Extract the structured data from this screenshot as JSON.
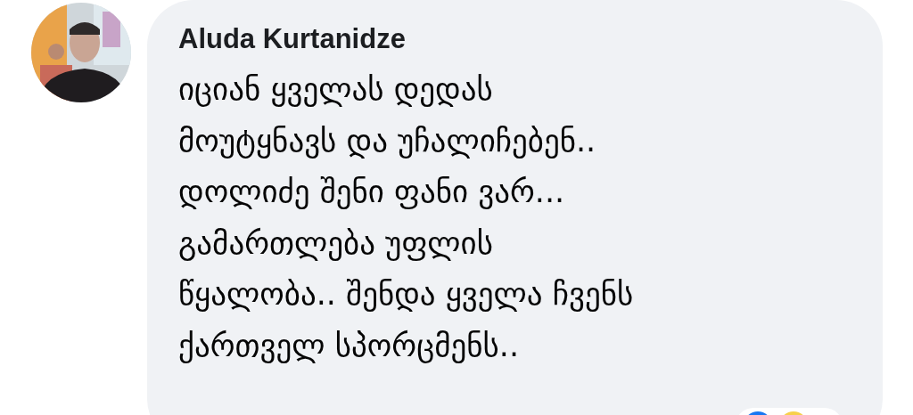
{
  "comment": {
    "author": "Aluda Kurtanidze",
    "text": "იციან ყველას დედას\nმოუტყნავს და უჩალიჩებენ..\nდოლიძე შენი ფანი ვარ...\nგამართლება უფლის\nწყალობა.. შენდა ყველა ჩვენს\nქართველ სპორცმენს.."
  }
}
